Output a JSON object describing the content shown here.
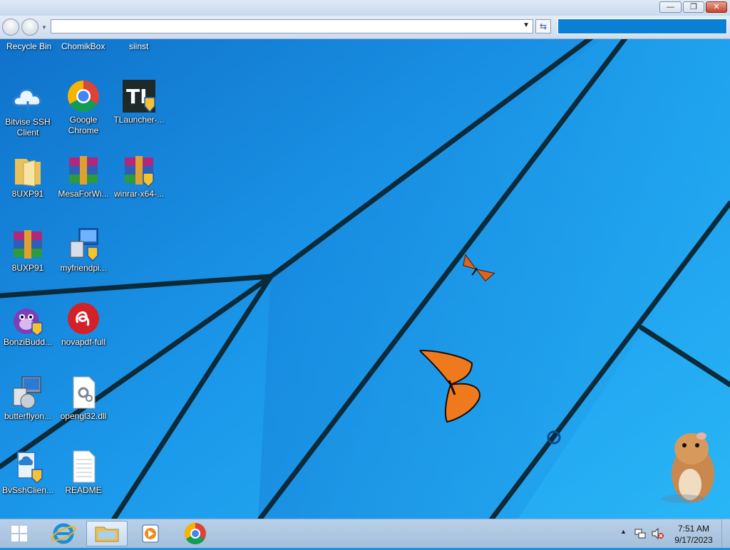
{
  "window": {
    "minimize_glyph": "—",
    "maximize_glyph": "❐",
    "close_glyph": "✕"
  },
  "navbar": {
    "address_value": "",
    "search_value": ""
  },
  "desktop": {
    "top_labels": [
      "Recycle Bin",
      "ChomikBox",
      "siinst"
    ],
    "icons": [
      {
        "label": "Bitvise SSH\nClient",
        "line1": "Bitvise SSH",
        "line2": "Client",
        "icon": "cloud-ssh-icon"
      },
      {
        "label": "Google Chrome",
        "line1": "Google",
        "line2": "Chrome",
        "icon": "chrome-icon"
      },
      {
        "label": "TLauncher-...",
        "line1": "TLauncher-...",
        "line2": "",
        "icon": "tlauncher-icon"
      },
      {
        "label": "8UXP91",
        "line1": "8UXP91",
        "line2": "",
        "icon": "folder-icon"
      },
      {
        "label": "MesaForWi...",
        "line1": "MesaForWi...",
        "line2": "",
        "icon": "winrar-icon"
      },
      {
        "label": "winrar-x64-...",
        "line1": "winrar-x64-...",
        "line2": "",
        "icon": "winrar-icon"
      },
      {
        "label": "8UXP91",
        "line1": "8UXP91",
        "line2": "",
        "icon": "winrar-icon"
      },
      {
        "label": "myfriendpi...",
        "line1": "myfriendpi...",
        "line2": "",
        "icon": "installer-icon"
      },
      {
        "label": "BonziBudd...",
        "line1": "BonziBudd...",
        "line2": "",
        "icon": "bonzi-icon"
      },
      {
        "label": "novapdf-full",
        "line1": "novapdf-full",
        "line2": "",
        "icon": "novapdf-icon"
      },
      {
        "label": "butterflyon...",
        "line1": "butterflyon...",
        "line2": "",
        "icon": "installer-icon"
      },
      {
        "label": "opengl32.dll",
        "line1": "opengl32.dll",
        "line2": "",
        "icon": "dll-file-icon"
      },
      {
        "label": "BvSshClien...",
        "line1": "BvSshClien...",
        "line2": "",
        "icon": "bvssh-installer-icon"
      },
      {
        "label": "README",
        "line1": "README",
        "line2": "",
        "icon": "text-file-icon"
      }
    ]
  },
  "taskbar": {
    "clock_time": "7:51 AM",
    "clock_date": "9/17/2023",
    "tray_chevron": "▲"
  },
  "colors": {
    "wallpaper": "#1a8fe0",
    "taskbar": "#a4bfdc"
  }
}
